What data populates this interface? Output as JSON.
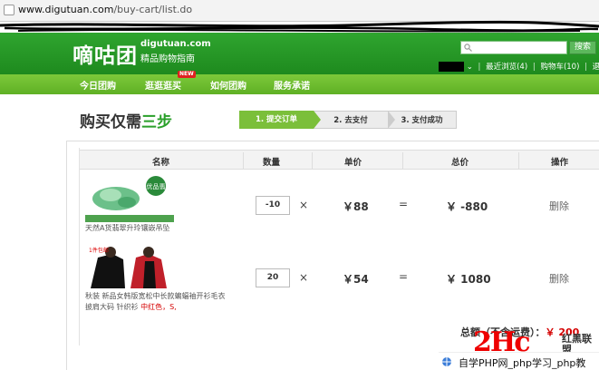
{
  "address_bar": {
    "domain": "www.digutuan.com",
    "path": "/buy-cart/list.do"
  },
  "header": {
    "logo_text": "嘀咕团",
    "site_domain": "digutuan.com",
    "slogan": "精品购物指南",
    "search_placeholder": "",
    "search_button": "搜索",
    "user_links": [
      "最近浏览(4)",
      "购物车(10)",
      "退"
    ]
  },
  "nav": {
    "items": [
      "今日团购",
      "逛逛逛买",
      "如何团购",
      "服务承诺"
    ],
    "new_badge": "NEW"
  },
  "steps": {
    "title_prefix": "购买仅需",
    "title_highlight": "三步",
    "items": [
      "1. 提交订单",
      "2. 去支付",
      "3. 支付成功"
    ]
  },
  "table": {
    "headers": [
      "名称",
      "数量",
      "单价",
      "总价",
      "操作"
    ],
    "rows": [
      {
        "name_line1": "天然A货翡翠升玲镶嵌吊坠",
        "name_line2": "",
        "name_highlight": "",
        "badge": "优品翡",
        "quantity": "-10",
        "times": "×",
        "unit_price": "￥88",
        "equals": "=",
        "total": "￥ -880",
        "action": "删除"
      },
      {
        "name_line1": "秋装 新品女韩版宽松中长款蝙蝠袖开衫毛衣",
        "name_line2": "披肩大码 针织衫",
        "name_highlight": "中红色，S,",
        "badge": "1件包邮",
        "quantity": "20",
        "times": "×",
        "unit_price": "￥54",
        "equals": "=",
        "total": "￥ 1080",
        "action": "删除"
      }
    ],
    "summary_label": "总额（不含运费）：",
    "summary_amount": "￥ 200"
  },
  "watermark": {
    "logo": "2Hc",
    "side_line1": "红黑联盟",
    "side_line2": "",
    "bar_text": "自学PHP网_php学习_php教"
  },
  "colors": {
    "brand_green": "#2aa02a",
    "nav_green": "#6fbf2e",
    "price_red": "#d40000"
  }
}
